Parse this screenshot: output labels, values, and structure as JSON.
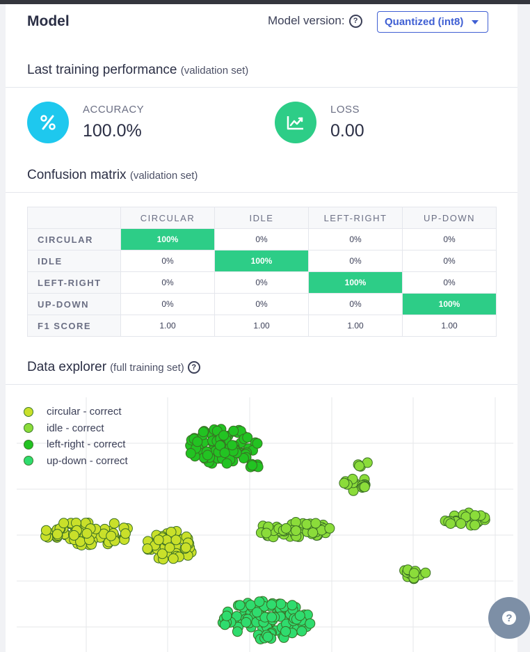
{
  "model": {
    "title": "Model",
    "version_label": "Model version:",
    "version_value": "Quantized (int8)"
  },
  "training": {
    "title": "Last training performance",
    "subtitle": "(validation set)",
    "accuracy_label": "ACCURACY",
    "accuracy_value": "100.0%",
    "accuracy_color": "#1ec8ee",
    "loss_label": "LOSS",
    "loss_value": "0.00",
    "loss_color": "#2dcd87"
  },
  "confusion": {
    "title": "Confusion matrix",
    "subtitle": "(validation set)",
    "columns": [
      "CIRCULAR",
      "IDLE",
      "LEFT-RIGHT",
      "UP-DOWN"
    ],
    "rows": [
      {
        "label": "CIRCULAR",
        "cells": [
          "100%",
          "0%",
          "0%",
          "0%"
        ]
      },
      {
        "label": "IDLE",
        "cells": [
          "0%",
          "100%",
          "0%",
          "0%"
        ]
      },
      {
        "label": "LEFT-RIGHT",
        "cells": [
          "0%",
          "0%",
          "100%",
          "0%"
        ]
      },
      {
        "label": "UP-DOWN",
        "cells": [
          "0%",
          "0%",
          "0%",
          "100%"
        ]
      }
    ],
    "f1_label": "F1 SCORE",
    "f1": [
      "1.00",
      "1.00",
      "1.00",
      "1.00"
    ],
    "highlight_color": "#2dcd87"
  },
  "explorer": {
    "title": "Data explorer",
    "subtitle": "(full training set)",
    "legend": [
      {
        "label": "circular - correct",
        "color": "#c9e02a"
      },
      {
        "label": "idle - correct",
        "color": "#8bdc3a"
      },
      {
        "label": "left-right - correct",
        "color": "#22c322"
      },
      {
        "label": "up-down - correct",
        "color": "#2fdc6e"
      }
    ]
  },
  "chart_data": {
    "type": "scatter",
    "grid": true,
    "legend_position": "top-left",
    "series": [
      {
        "name": "circular - correct",
        "color": "#c9e02a",
        "clusters": [
          {
            "cx": 100,
            "cy": 195,
            "rx": 65,
            "ry": 18,
            "n": 70
          },
          {
            "cx": 222,
            "cy": 213,
            "rx": 35,
            "ry": 22,
            "n": 40
          }
        ]
      },
      {
        "name": "idle - correct",
        "color": "#8bdc3a",
        "clusters": [
          {
            "cx": 400,
            "cy": 191,
            "rx": 55,
            "ry": 12,
            "n": 60
          },
          {
            "cx": 490,
            "cy": 125,
            "rx": 20,
            "ry": 10,
            "n": 18
          },
          {
            "cx": 498,
            "cy": 96,
            "rx": 10,
            "ry": 4,
            "n": 4
          },
          {
            "cx": 645,
            "cy": 175,
            "rx": 32,
            "ry": 11,
            "n": 25
          },
          {
            "cx": 570,
            "cy": 252,
            "rx": 18,
            "ry": 9,
            "n": 12
          }
        ]
      },
      {
        "name": "left-right - correct",
        "color": "#22c322",
        "clusters": [
          {
            "cx": 295,
            "cy": 70,
            "rx": 52,
            "ry": 26,
            "n": 90
          },
          {
            "cx": 345,
            "cy": 98,
            "rx": 10,
            "ry": 5,
            "n": 6
          }
        ]
      },
      {
        "name": "up-down - correct",
        "color": "#2fdc6e",
        "clusters": [
          {
            "cx": 360,
            "cy": 320,
            "rx": 65,
            "ry": 28,
            "n": 110
          }
        ]
      }
    ]
  }
}
